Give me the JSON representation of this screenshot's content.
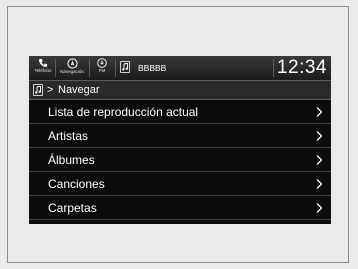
{
  "topbar": {
    "phone_label": "Teléfono",
    "nav_label": "Navegación",
    "fm_label": "FM",
    "source_name": "BBBBB",
    "clock": "12:34"
  },
  "breadcrumb": {
    "arrow": ">",
    "label": "Navegar"
  },
  "menu": {
    "items": [
      {
        "label": "Lista de reproducción actual"
      },
      {
        "label": "Artistas"
      },
      {
        "label": "Álbumes"
      },
      {
        "label": "Canciones"
      },
      {
        "label": "Carpetas"
      }
    ]
  },
  "icons": {
    "phone": "phone-icon",
    "navigation": "navigation-icon",
    "fm": "radio-icon",
    "source": "music-note-icon",
    "chevron": "chevron-right-icon"
  },
  "colors": {
    "screen_bg": "#0c0c0c",
    "text": "#ffffff",
    "page_bg": "#ebebeb"
  }
}
